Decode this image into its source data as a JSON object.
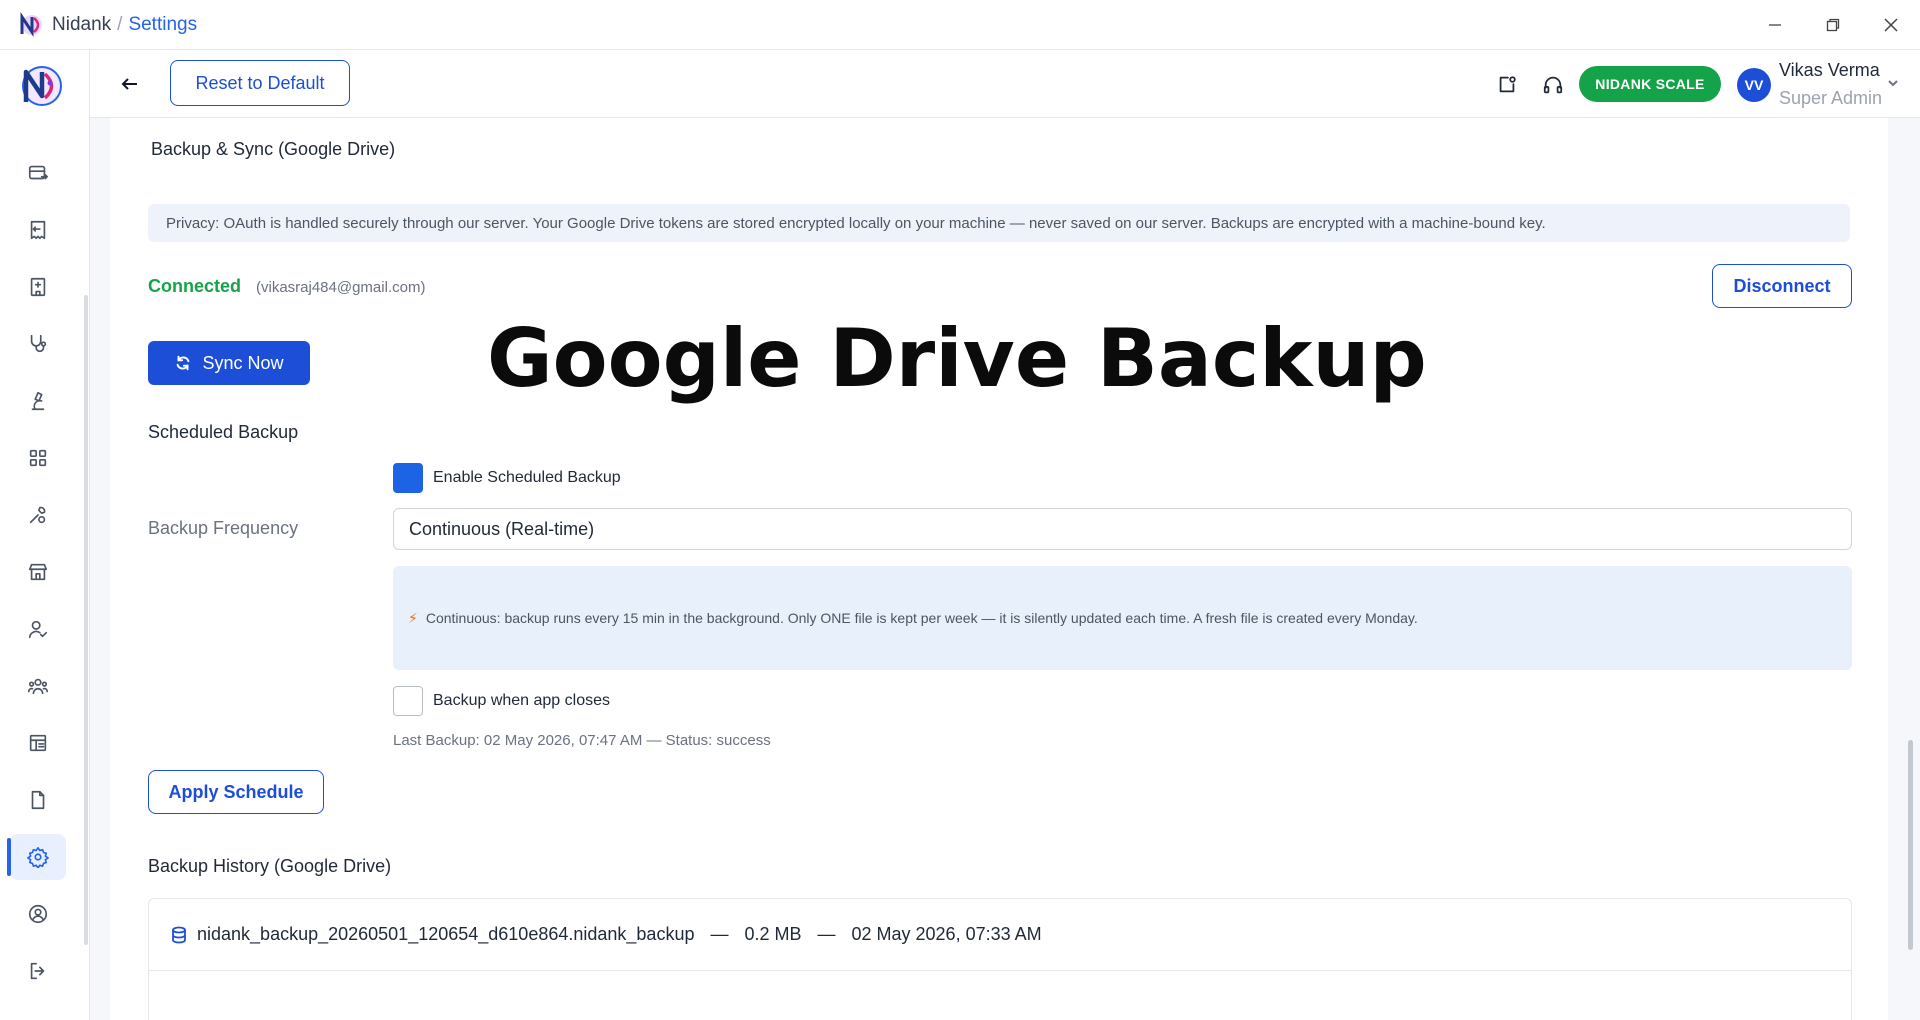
{
  "titlebar": {
    "app_name": "Nidank",
    "separator": "/",
    "current_page": "Settings"
  },
  "header": {
    "reset_label": "Reset to Default",
    "scale_label": "NIDANK SCALE",
    "user_initials": "VV",
    "user_name": "Vikas Verma",
    "user_role": "Super Admin"
  },
  "sidebar": {
    "items": [
      {
        "icon": "billing-icon"
      },
      {
        "icon": "receipt-icon"
      },
      {
        "icon": "hospital-icon"
      },
      {
        "icon": "stethoscope-icon"
      },
      {
        "icon": "microscope-icon"
      },
      {
        "icon": "grid-icon"
      },
      {
        "icon": "tools-icon"
      },
      {
        "icon": "store-icon"
      },
      {
        "icon": "user-check-icon"
      },
      {
        "icon": "users-icon"
      },
      {
        "icon": "layout-list-icon"
      },
      {
        "icon": "document-icon"
      },
      {
        "icon": "settings-icon",
        "active": true
      },
      {
        "icon": "user-circle-icon"
      },
      {
        "icon": "logout-icon"
      }
    ]
  },
  "backup": {
    "section_title": "Backup & Sync (Google Drive)",
    "privacy_note": "Privacy: OAuth is handled securely through our server. Your Google Drive tokens are stored encrypted locally on your machine — never saved on our server. Backups are encrypted with a machine-bound key.",
    "status": "Connected",
    "email": "(vikasraj484@gmail.com)",
    "disconnect_label": "Disconnect",
    "sync_label": "Sync Now",
    "overlay_title": "Google Drive Backup"
  },
  "schedule": {
    "title": "Scheduled Backup",
    "enable_label": "Enable Scheduled Backup",
    "enable_checked": true,
    "frequency_label": "Backup Frequency",
    "frequency_value": "Continuous (Real-time)",
    "info_text": "Continuous: backup runs every 15 min in the background. Only ONE file is kept per week — it is silently updated each time. A fresh file is created every Monday.",
    "close_label": "Backup when app closes",
    "close_checked": false,
    "last_backup": "Last Backup: 02 May 2026, 07:47 AM — Status: success",
    "apply_label": "Apply Schedule"
  },
  "history": {
    "title": "Backup History (Google Drive)",
    "rows": [
      {
        "file": "nidank_backup_20260501_120654_d610e864.nidank_backup",
        "size": "0.2 MB",
        "date": "02 May 2026, 07:33 AM"
      }
    ],
    "dash": "—"
  },
  "colors": {
    "accent": "#1d4ed8",
    "success": "#16a34a",
    "scale_green": "#15a34a"
  }
}
